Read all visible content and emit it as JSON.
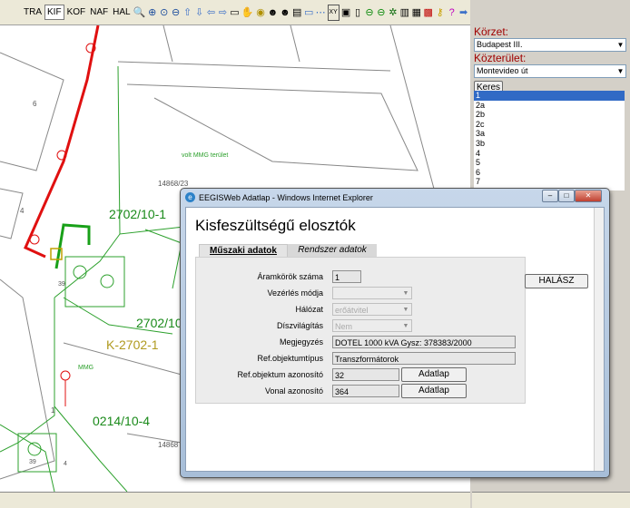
{
  "toolbar": {
    "modes": [
      "TRA",
      "KIF",
      "KOF",
      "NAF",
      "HAL"
    ],
    "active_mode": "KIF"
  },
  "map": {
    "labels": {
      "n6": "6",
      "n4": "4",
      "n1": "1",
      "mmg_area": "volt MMG terület",
      "mmg": "MMG",
      "parcel1": "14868/23",
      "parcel2": "14868",
      "st1": "2702/10-1",
      "st2": "2702/10",
      "k": "K-2702-1",
      "st3": "0214/10-4",
      "n39": "39",
      "n39b": "39",
      "n4b": "4"
    }
  },
  "side": {
    "district_label": "Körzet:",
    "district_value": "Budapest III.",
    "street_label": "Közterület:",
    "street_value": "Montevideo út",
    "search_button": "Keres",
    "numbers": [
      "1",
      "2a",
      "2b",
      "2c",
      "3a",
      "3b",
      "4",
      "5",
      "6",
      "7"
    ],
    "selected": "1",
    "search2_button": "HALÁSZ"
  },
  "dialog": {
    "window_title": "EEGISWeb Adatlap - Windows Internet Explorer",
    "heading": "Kisfeszültségű elosztók",
    "tab_tech": "Műszaki adatok",
    "tab_sys": "Rendszer adatok",
    "fields": {
      "circuits_label": "Áramkörök száma",
      "circuits_value": "1",
      "control_label": "Vezérlés módja",
      "control_value": "",
      "network_label": "Hálózat",
      "network_value": "erőátvitel",
      "lighting_label": "Díszvilágítás",
      "lighting_value": "Nem",
      "note_label": "Megjegyzés",
      "note_value": "DOTEL 1000 kVA    Gysz: 378383/2000",
      "refobj_type_label": "Ref.objektumtípus",
      "refobj_type_value": "Transzformátorok",
      "refobj_id_label": "Ref.objektum azonosító",
      "refobj_id_value": "32",
      "line_id_label": "Vonal azonosító",
      "line_id_value": "364",
      "datasheet_button": "Adatlap"
    }
  }
}
